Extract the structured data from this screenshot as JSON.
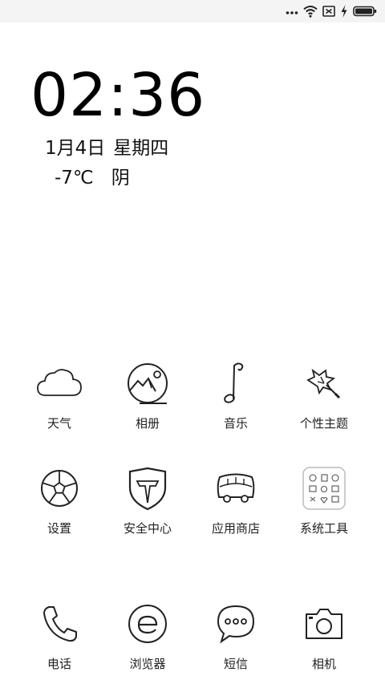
{
  "status_bar": {
    "icons": [
      "more-dots-icon",
      "wifi-icon",
      "no-sim-icon",
      "charging-bolt-icon",
      "battery-icon"
    ]
  },
  "clock": {
    "time": "02:36"
  },
  "date": {
    "date": "1月4日",
    "weekday": "星期四"
  },
  "weather": {
    "temperature": "-7℃",
    "condition": "阴"
  },
  "apps": [
    {
      "label": "天气",
      "icon": "weather-cloud-icon"
    },
    {
      "label": "相册",
      "icon": "gallery-icon"
    },
    {
      "label": "音乐",
      "icon": "music-note-icon"
    },
    {
      "label": "个性主题",
      "icon": "themes-icon"
    },
    {
      "label": "设置",
      "icon": "settings-gear-icon"
    },
    {
      "label": "安全中心",
      "icon": "security-shield-icon"
    },
    {
      "label": "应用商店",
      "icon": "app-store-bus-icon"
    },
    {
      "label": "系统工具",
      "icon": "system-tools-folder-icon"
    },
    {
      "label": "电话",
      "icon": "phone-handset-icon"
    },
    {
      "label": "浏览器",
      "icon": "browser-icon"
    },
    {
      "label": "短信",
      "icon": "messages-bubble-icon"
    },
    {
      "label": "相机",
      "icon": "camera-icon"
    }
  ]
}
